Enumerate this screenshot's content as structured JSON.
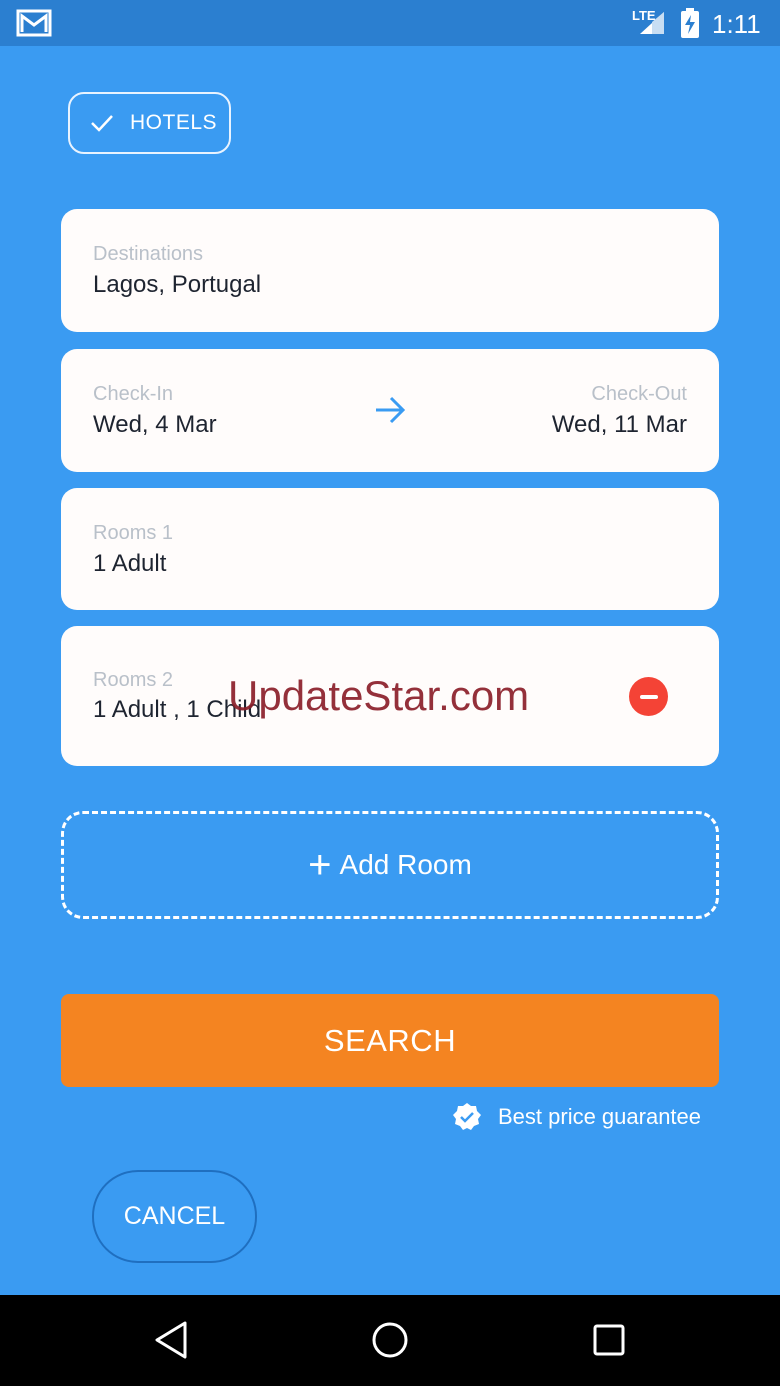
{
  "status_bar": {
    "time": "1:11",
    "network": "LTE"
  },
  "tab": {
    "label": "HOTELS"
  },
  "destination": {
    "label": "Destinations",
    "value": "Lagos, Portugal"
  },
  "dates": {
    "checkin_label": "Check-In",
    "checkin_value": "Wed, 4 Mar",
    "checkout_label": "Check-Out",
    "checkout_value": "Wed, 11 Mar"
  },
  "rooms": [
    {
      "label": "Rooms 1",
      "value": "1 Adult"
    },
    {
      "label": "Rooms 2",
      "value": "1 Adult , 1 Child"
    }
  ],
  "watermark": "UpdateStar.com",
  "add_room": {
    "label": "Add Room"
  },
  "search": {
    "label": "SEARCH"
  },
  "guarantee": {
    "label": "Best price guarantee"
  },
  "cancel": {
    "label": "CANCEL"
  },
  "colors": {
    "background": "#3a9bf2",
    "search": "#f48421",
    "remove": "#f44336",
    "arrow": "#3a9bf2"
  }
}
